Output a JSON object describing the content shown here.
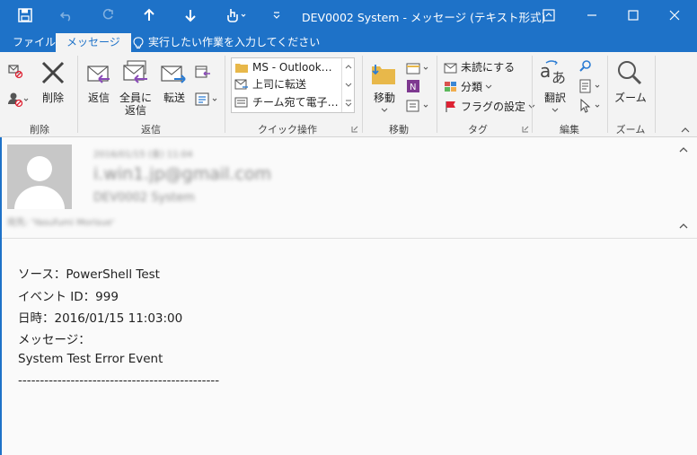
{
  "window": {
    "title": "DEV0002 System - メッセージ (テキスト形式)"
  },
  "tabs": [
    {
      "label": "ファイル"
    },
    {
      "label": "メッセージ"
    }
  ],
  "tell_me": "実行したい作業を入力してください",
  "ribbon": {
    "delete_label": "削除",
    "reply_label": "返信",
    "reply_all_label_1": "全員に",
    "reply_all_label_2": "返信",
    "forward_label": "転送",
    "quicksteps": [
      "MS - Outlook…",
      "上司に転送",
      "チーム宛て電子…"
    ],
    "move_label": "移動",
    "unread_label": "未読にする",
    "categorize_label": "分類",
    "followup_label": "フラグの設定",
    "translate_label": "翻訳",
    "zoom_label": "ズーム",
    "groups": {
      "delete": "削除",
      "respond": "返信",
      "quicksteps": "クイック操作",
      "move": "移動",
      "tags": "タグ",
      "editing": "編集",
      "zoom": "ズーム"
    }
  },
  "message": {
    "date": "2016/01/15 (金) 11:04",
    "sender": "i.win1.jp@gmail.com",
    "subject": "DEV0002 System",
    "to": "宛先: 'Yasufumi Morisue'",
    "body": [
      "ソース：PowerShell Test",
      "イベント ID：999",
      "日時：2016/01/15 11:03:00",
      "メッセージ：",
      "System Test Error Event",
      "----------------------------------------------"
    ]
  },
  "colors": {
    "accent": "#1e72c8",
    "ribbon_bg": "#f3f3f3",
    "pane_bg": "#fafafa"
  }
}
